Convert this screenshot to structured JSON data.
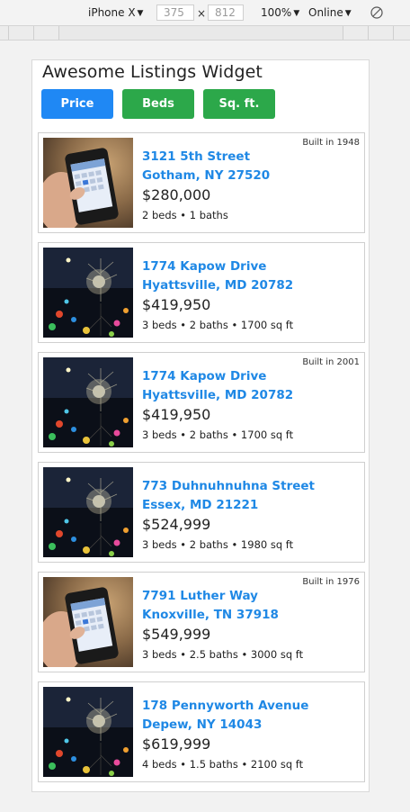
{
  "devtools": {
    "device": "iPhone X",
    "width": "375",
    "times": "×",
    "height": "812",
    "zoom": "100%",
    "network": "Online"
  },
  "widget": {
    "title": "Awesome Listings Widget",
    "sort_buttons": [
      {
        "label": "Price",
        "color": "#1f88f4"
      },
      {
        "label": "Beds",
        "color": "#2ca84a"
      },
      {
        "label": "Sq. ft.",
        "color": "#2ca84a"
      }
    ],
    "listings": [
      {
        "image": "phone-photo",
        "built": "Built in 1948",
        "street": "3121 5th Street",
        "city": "Gotham, NY 27520",
        "price": "$280,000",
        "details": "2 beds • 1 baths"
      },
      {
        "image": "night-tree-photo",
        "built": "",
        "street": "1774 Kapow Drive",
        "city": "Hyattsville, MD 20782",
        "price": "$419,950",
        "details": "3 beds • 2 baths • 1700 sq ft"
      },
      {
        "image": "night-tree-photo",
        "built": "Built in 2001",
        "street": "1774 Kapow Drive",
        "city": "Hyattsville, MD 20782",
        "price": "$419,950",
        "details": "3 beds • 2 baths • 1700 sq ft"
      },
      {
        "image": "night-tree-photo",
        "built": "",
        "street": "773 Duhnuhnuhna Street",
        "city": "Essex, MD 21221",
        "price": "$524,999",
        "details": "3 beds • 2 baths • 1980 sq ft"
      },
      {
        "image": "phone-photo",
        "built": "Built in 1976",
        "street": "7791 Luther Way",
        "city": "Knoxville, TN 37918",
        "price": "$549,999",
        "details": "3 beds • 2.5 baths • 3000 sq ft"
      },
      {
        "image": "night-tree-photo",
        "built": "",
        "street": "178 Pennyworth Avenue",
        "city": "Depew, NY 14043",
        "price": "$619,999",
        "details": "4 beds • 1.5 baths • 2100 sq ft"
      }
    ]
  }
}
